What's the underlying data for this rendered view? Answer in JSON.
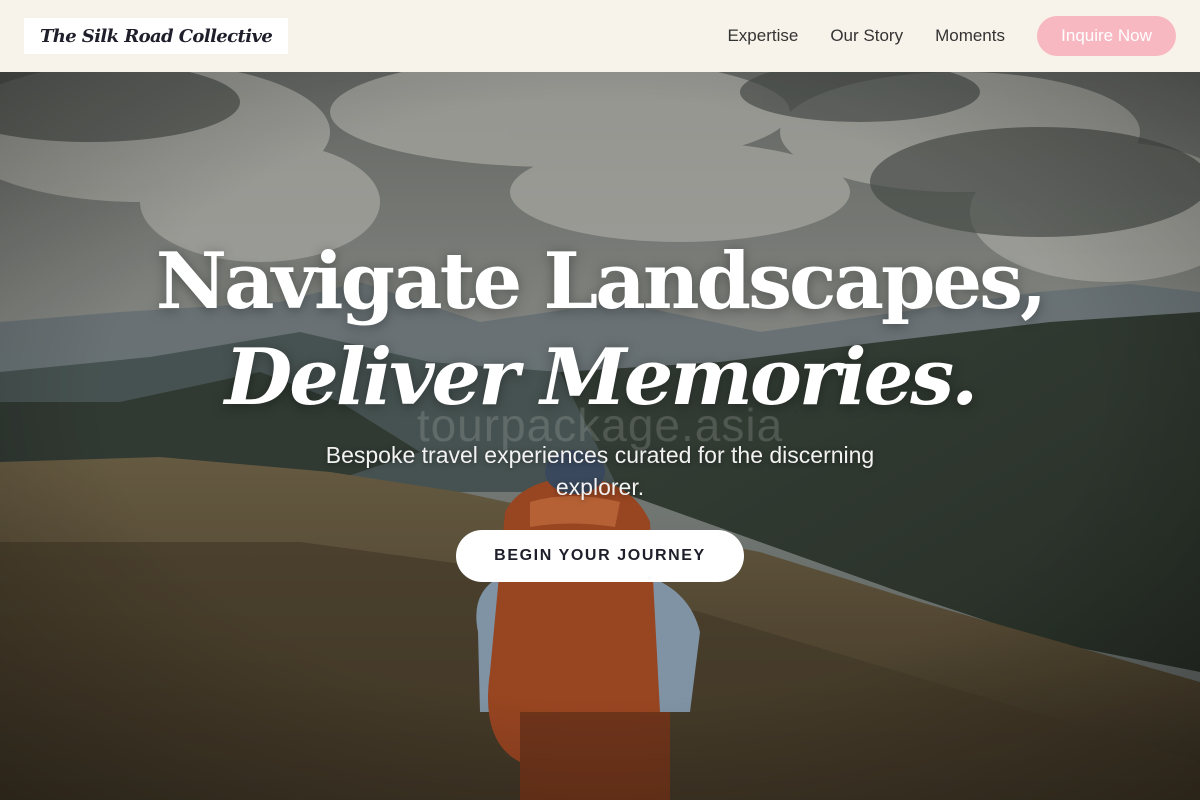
{
  "brand": {
    "name": "The Silk Road Collective"
  },
  "nav": {
    "links": [
      "Expertise",
      "Our Story",
      "Moments"
    ],
    "cta_label": "Inquire Now"
  },
  "hero": {
    "headline_line1": "Navigate Landscapes,",
    "headline_line2": "Deliver Memories.",
    "subtitle": "Bespoke travel experiences curated for the discerning explorer.",
    "button_label": "BEGIN YOUR JOURNEY",
    "watermark": "tourpackage.asia"
  },
  "colors": {
    "header_bg": "#f8f3ea",
    "cta_bg": "#f7b8c2",
    "text_dark": "#1f1f2b",
    "hero_text": "#ffffff"
  }
}
